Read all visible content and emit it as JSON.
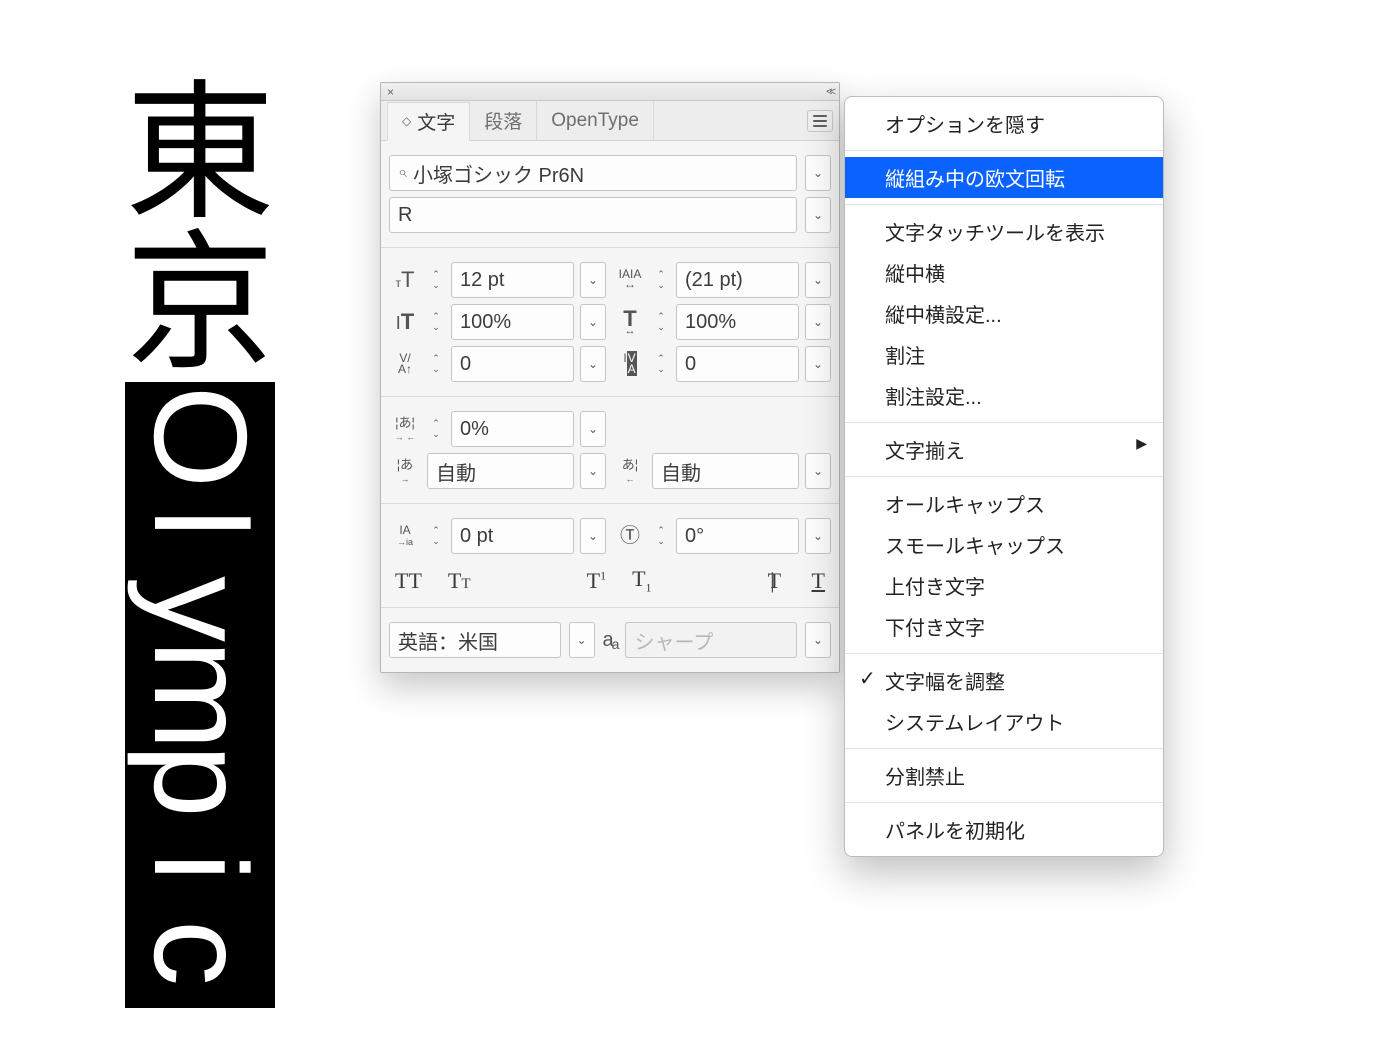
{
  "sample_text": {
    "kanji_1": "東",
    "kanji_2": "京",
    "roman": [
      "O",
      "l",
      "y",
      "m",
      "p",
      "i",
      "c"
    ]
  },
  "panel": {
    "close_glyph": "×",
    "collapse_glyph": "<<",
    "tabs": {
      "character": "文字",
      "paragraph": "段落",
      "opentype": "OpenType"
    },
    "font_family": "小塚ゴシック Pr6N",
    "font_style": "R",
    "font_size": "12 pt",
    "leading": "(21 pt)",
    "vertical_scale": "100%",
    "horizontal_scale": "100%",
    "kerning": "0",
    "tracking": "0",
    "tsume": "0%",
    "aki_left": "自動",
    "aki_right": "自動",
    "baseline_shift": "0 pt",
    "rotation": "0°",
    "language": "英語：米国",
    "antialias": "シャープ",
    "icons": {
      "font_size": "тT",
      "leading": "IAIA",
      "vscale": "IT",
      "hscale": "T",
      "kerning": "V/A",
      "tracking": "IVA",
      "tsume": "あ",
      "aki": "あ",
      "baseline": "IA",
      "rotation": "T",
      "allcaps": "TT",
      "smallcaps": "Tᴛ",
      "superscript": "T¹",
      "subscript": "T₁",
      "strike": "T",
      "underline": "T"
    }
  },
  "menu": {
    "hide_options": "オプションを隠す",
    "rotate_roman": "縦組み中の欧文回転",
    "touch_tool": "文字タッチツールを表示",
    "tcy": "縦中横",
    "tcy_settings": "縦中横設定...",
    "warichu": "割注",
    "warichu_settings": "割注設定...",
    "moji_soroe": "文字揃え",
    "all_caps": "オールキャップス",
    "small_caps": "スモールキャップス",
    "sup": "上付き文字",
    "sub": "下付き文字",
    "adjust_width": "文字幅を調整",
    "system_layout": "システムレイアウト",
    "no_break": "分割禁止",
    "reset": "パネルを初期化"
  }
}
